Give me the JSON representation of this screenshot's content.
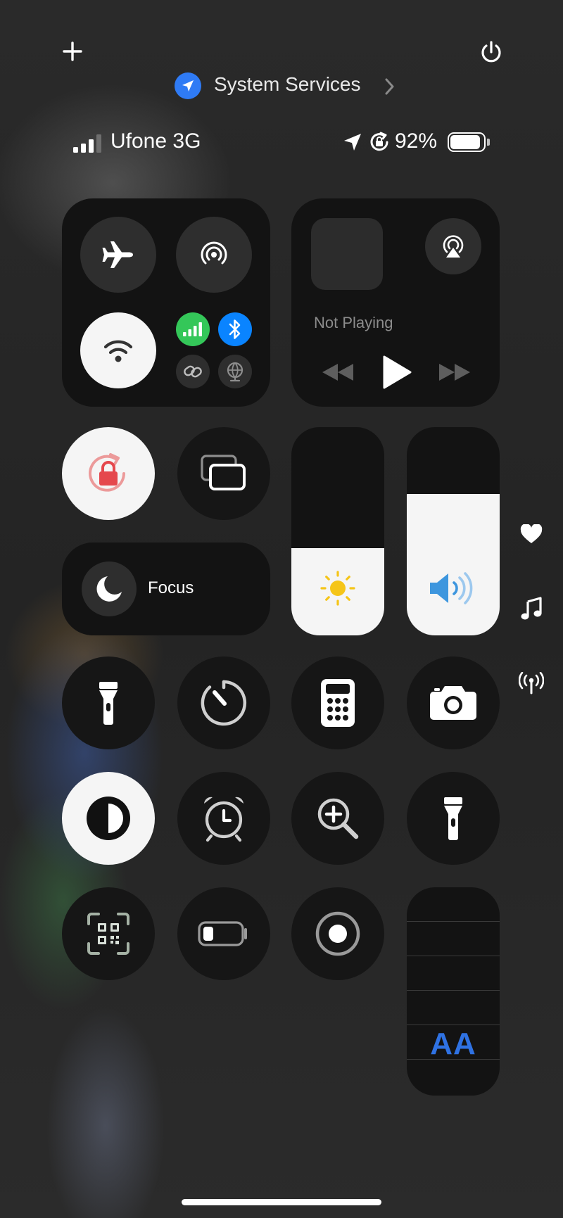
{
  "header": {
    "location_app": "System Services",
    "icons": {
      "add": "plus-icon",
      "power": "power-icon",
      "location": "location-arrow-icon",
      "chevron": "chevron-right-icon"
    }
  },
  "status_bar": {
    "carrier": "Ufone 3G",
    "battery_percent": "92%",
    "battery_level": 0.92,
    "signal_bars": 3,
    "icons": [
      "location-arrow-icon",
      "orientation-lock-icon",
      "battery-icon"
    ]
  },
  "connectivity": {
    "airplane_mode": "airplane-icon",
    "airdrop": "airdrop-icon",
    "wifi": "wifi-icon",
    "cellular": "cellular-icon",
    "bluetooth": "bluetooth-icon",
    "hotspot": "link-icon",
    "vpn": "globe-icon",
    "colors": {
      "cellular": "#34c759",
      "bluetooth": "#0a84ff"
    }
  },
  "media": {
    "status": "Not Playing",
    "icons": {
      "airplay": "airplay-icon",
      "previous": "rewind-icon",
      "play": "play-icon",
      "next": "fast-forward-icon"
    }
  },
  "controls": {
    "focus_label": "Focus",
    "brightness_level": 0.42,
    "volume_level": 0.68,
    "lock_color": "#e5484d",
    "brightness_color": "#f5c518",
    "volume_color": "#3d96de",
    "text_size_label": "AA",
    "text_size_color": "#2f72e3"
  },
  "side_icons": [
    "heart-icon",
    "music-note-icon",
    "antenna-icon"
  ]
}
